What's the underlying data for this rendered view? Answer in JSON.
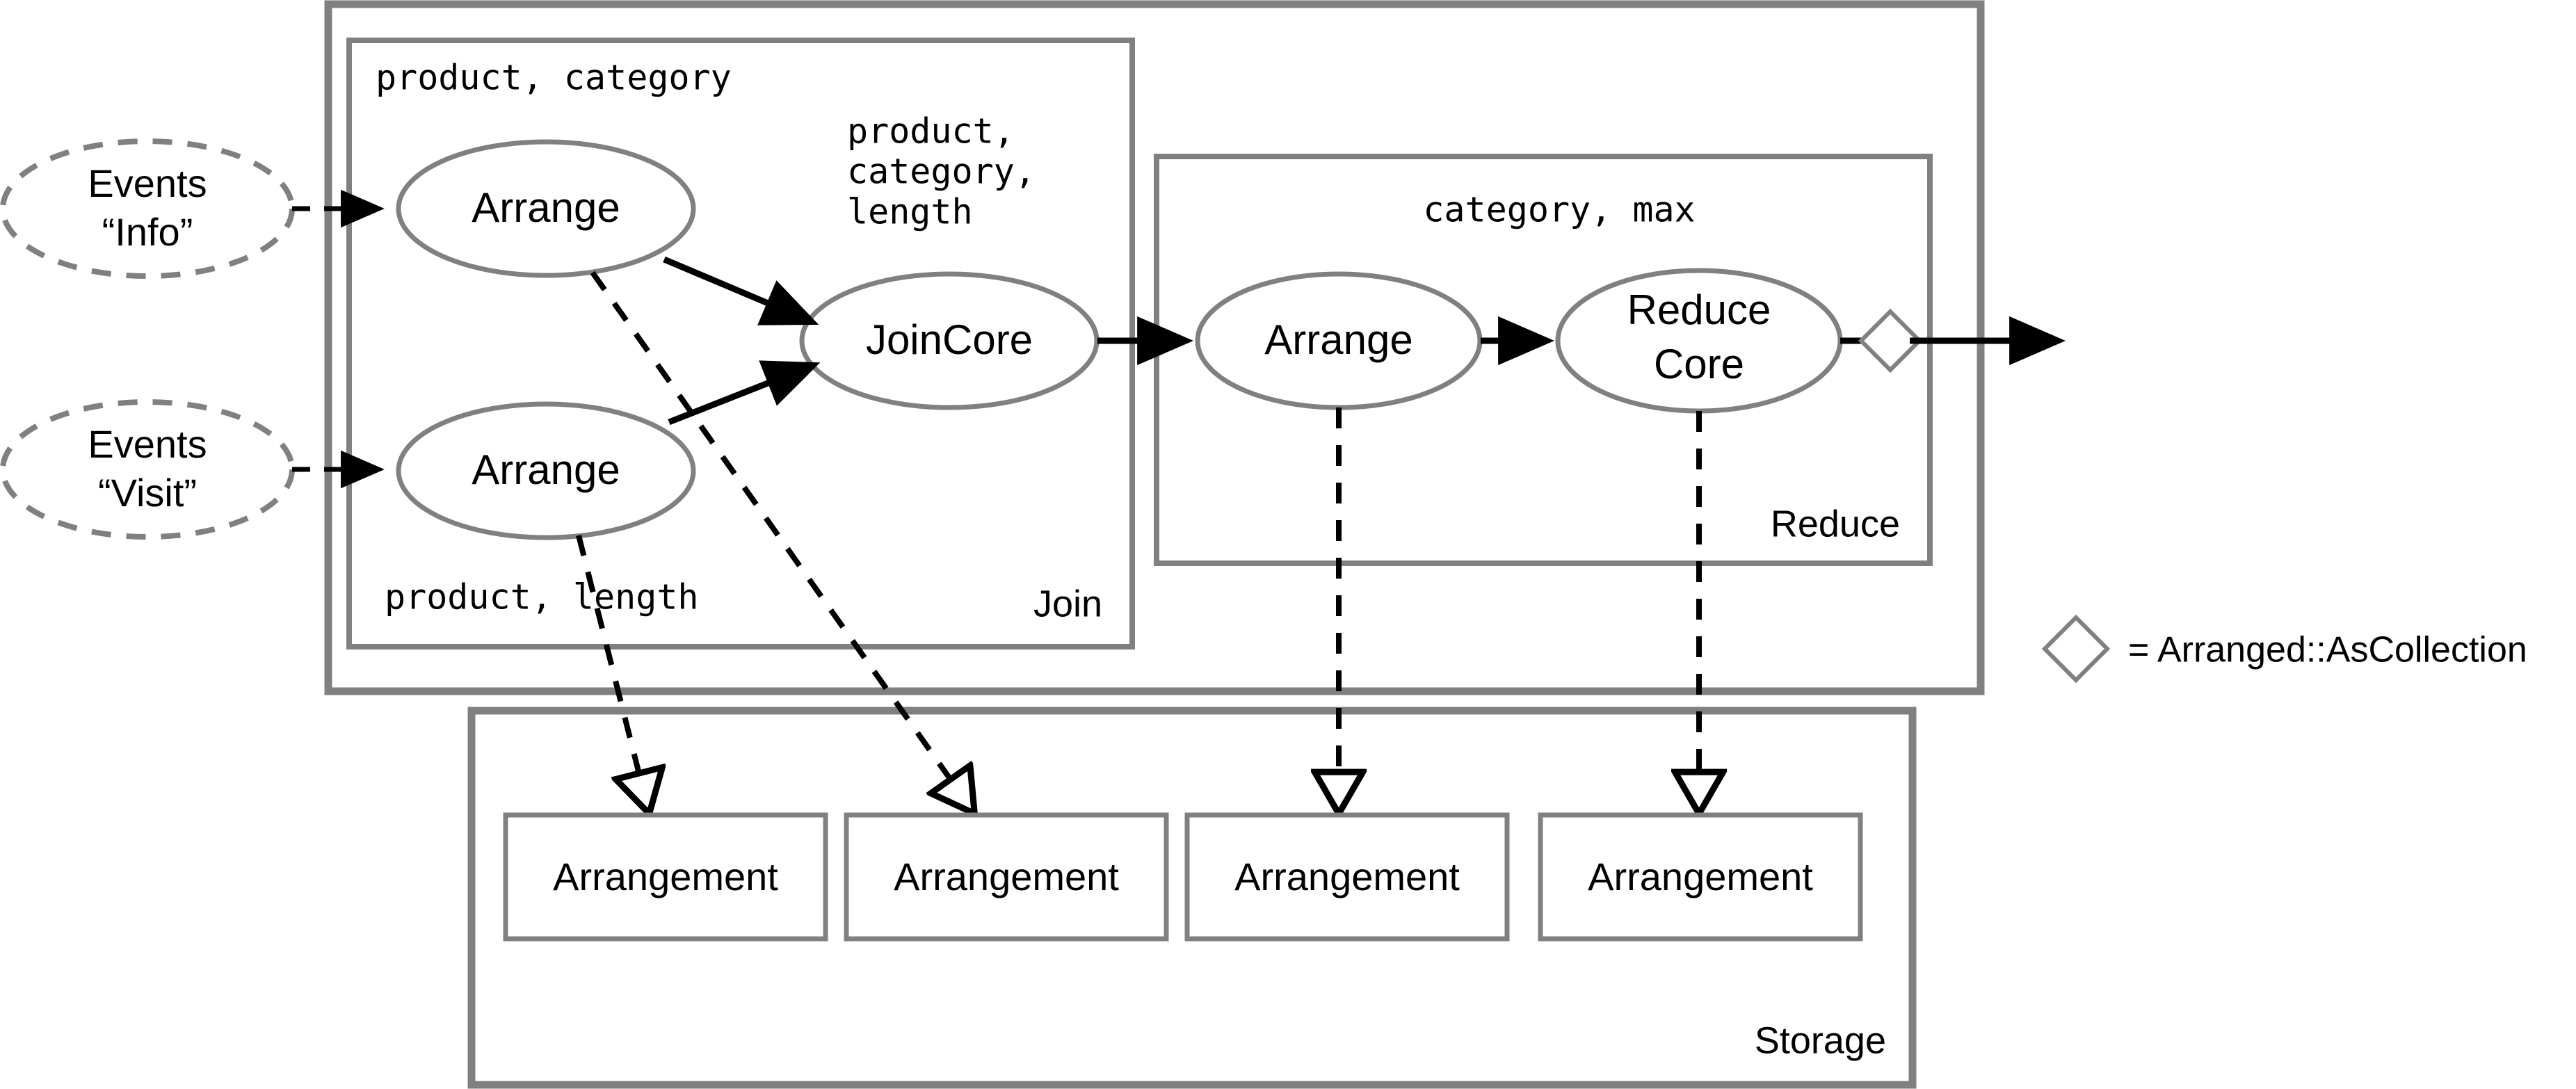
{
  "diagram": {
    "title_semantics": "differential dataflow operator graph",
    "colors": {
      "container_stroke": "#808080",
      "node_stroke": "#808080",
      "edge_stroke": "#000000",
      "text": "#000000",
      "background": "#ffffff"
    },
    "sources": [
      {
        "id": "events-info",
        "label_line1": "Events",
        "label_line2": "“Info”",
        "shape": "dashed-ellipse"
      },
      {
        "id": "events-visit",
        "label_line1": "Events",
        "label_line2": "“Visit”",
        "shape": "dashed-ellipse"
      }
    ],
    "containers": [
      {
        "id": "dataflow",
        "label": ""
      },
      {
        "id": "join",
        "label": "Join"
      },
      {
        "id": "reduce",
        "label": "Reduce"
      },
      {
        "id": "storage",
        "label": "Storage"
      }
    ],
    "operators": [
      {
        "id": "arrange-info",
        "label": "Arrange",
        "lines": [
          "Arrange"
        ]
      },
      {
        "id": "arrange-visit",
        "label": "Arrange",
        "lines": [
          "Arrange"
        ]
      },
      {
        "id": "joincore",
        "label": "JoinCore",
        "lines": [
          "JoinCore"
        ]
      },
      {
        "id": "arrange-reduce",
        "label": "Arrange",
        "lines": [
          "Arrange"
        ]
      },
      {
        "id": "reducecore",
        "label": "Reduce Core",
        "lines": [
          "Reduce",
          "Core"
        ]
      }
    ],
    "key_labels": [
      {
        "id": "key-arrange-info",
        "text": "product, category"
      },
      {
        "id": "key-joincore",
        "lines": [
          "product,",
          "category,",
          "length"
        ]
      },
      {
        "id": "key-arrange-visit",
        "text": "product, length"
      },
      {
        "id": "key-reducecore",
        "text": "category, max"
      }
    ],
    "arrangements": [
      {
        "id": "arrangement-1",
        "label": "Arrangement"
      },
      {
        "id": "arrangement-2",
        "label": "Arrangement"
      },
      {
        "id": "arrangement-3",
        "label": "Arrangement"
      },
      {
        "id": "arrangement-4",
        "label": "Arrangement"
      }
    ],
    "legend": {
      "symbol": "diamond",
      "equals": "=",
      "text": "Arranged::AsCollection",
      "full": "= Arranged::AsCollection"
    }
  }
}
